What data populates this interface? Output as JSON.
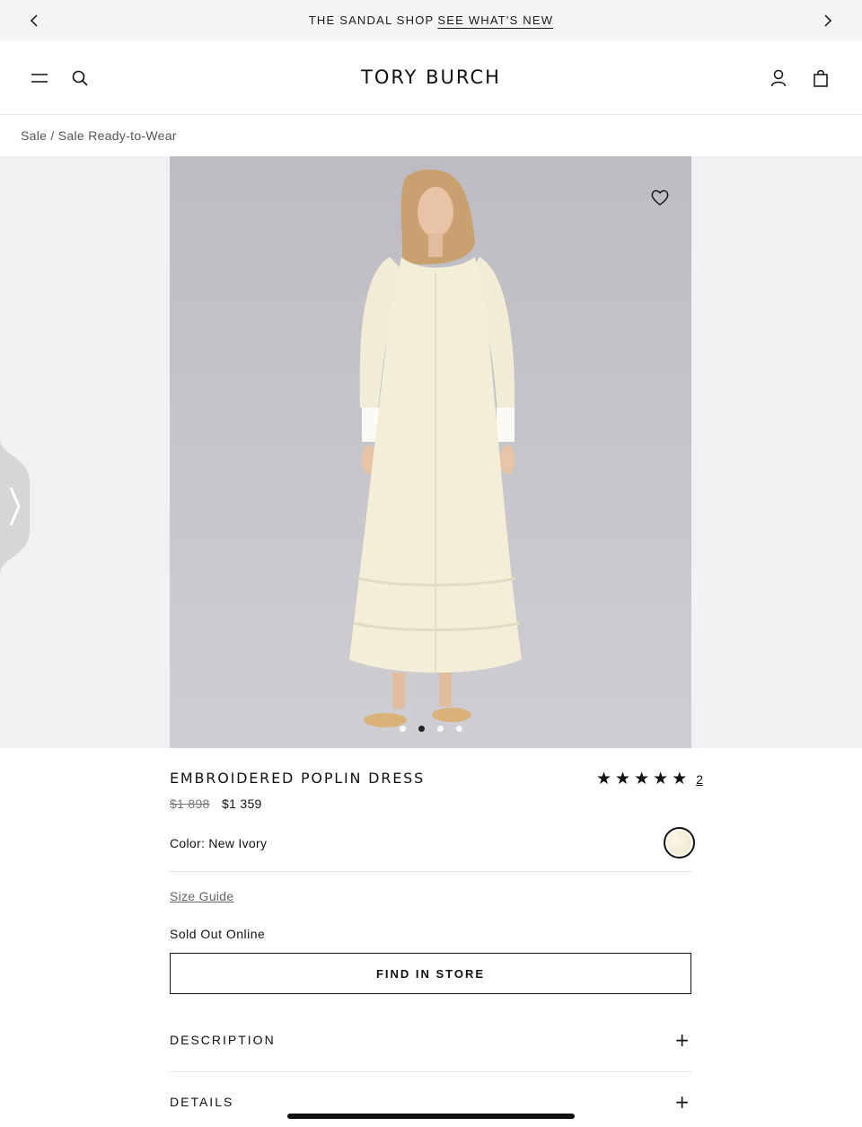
{
  "promo": {
    "text": "THE SANDAL SHOP",
    "link": "SEE WHAT'S NEW"
  },
  "header": {
    "brand": "TORY BURCH"
  },
  "breadcrumb": "Sale / Sale Ready-to-Wear",
  "gallery": {
    "dot_count": 4,
    "active_dot": 1
  },
  "product": {
    "title": "EMBROIDERED POPLIN DRESS",
    "rating_stars": 5,
    "review_count": "2",
    "price_original": "$1 898",
    "price_sale": "$1 359",
    "color_label": "Color: New Ivory",
    "size_guide": "Size Guide",
    "availability": "Sold Out Online",
    "find_in_store": "FIND IN STORE"
  },
  "accordion": [
    {
      "label": "DESCRIPTION"
    },
    {
      "label": "DETAILS"
    }
  ],
  "icons": [
    "chevron-left-icon",
    "chevron-right-icon",
    "menu-icon",
    "search-icon",
    "account-icon",
    "bag-icon",
    "heart-icon",
    "plus-icon",
    "star-icon"
  ]
}
